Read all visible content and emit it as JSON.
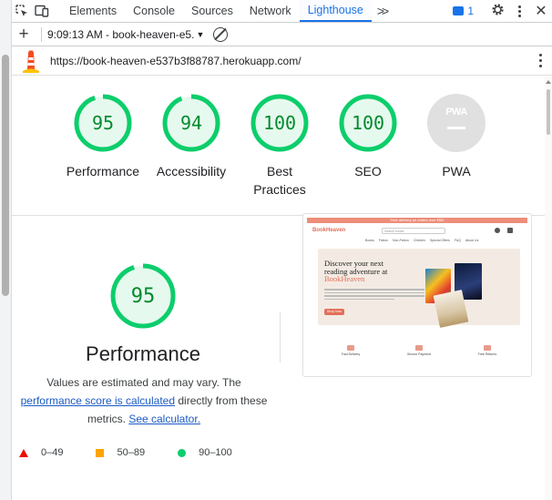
{
  "tabs": [
    "Elements",
    "Console",
    "Sources",
    "Network",
    "Lighthouse"
  ],
  "active_tab": "Lighthouse",
  "more_tabs_label": ">>",
  "issues_count": "1",
  "toolbar": {
    "report_label": "9:09:13 AM - book-heaven-e5."
  },
  "url": "https://book-heaven-e537b3f88787.herokuapp.com/",
  "scores": [
    {
      "value": "95",
      "label": "Performance",
      "score": 95
    },
    {
      "value": "94",
      "label": "Accessibility",
      "score": 94
    },
    {
      "value": "100",
      "label": "Best Practices",
      "score": 100
    },
    {
      "value": "100",
      "label": "SEO",
      "score": 100
    }
  ],
  "pwa": {
    "badge": "PWA",
    "label": "PWA"
  },
  "performance": {
    "score": "95",
    "score_fraction": 0.95,
    "title": "Performance",
    "desc_1": "Values are estimated and may vary. The",
    "link_1": "performance score is calculated",
    "desc_2": "directly from these",
    "desc_3": "metrics.",
    "link_2": "See calculator."
  },
  "legend": [
    {
      "range": "0–49",
      "color": "#eb0f00"
    },
    {
      "range": "50–89",
      "color": "#ffa400"
    },
    {
      "range": "90–100",
      "color": "#0cce6b"
    }
  ],
  "screenshot": {
    "topbar": "Free delivery on orders over €50!",
    "logo": "BookHeaven",
    "search_placeholder": "Search books",
    "nav": [
      "Books",
      "Fiction",
      "Non-Fiction",
      "Children",
      "Special Offers",
      "FAQ",
      "About Us"
    ],
    "hero_line1": "Discover your next",
    "hero_line2": "reading adventure at",
    "hero_brand": "BookHeaven",
    "hero_button": "Shop Now",
    "features": [
      "Fast Delivery",
      "Secure Payment",
      "Free Returns"
    ]
  },
  "colors": {
    "pass": "#0cce6b",
    "pass_text": "#008a2e",
    "pass_fill": "#e6f9ee",
    "accent": "#1a73e8"
  }
}
